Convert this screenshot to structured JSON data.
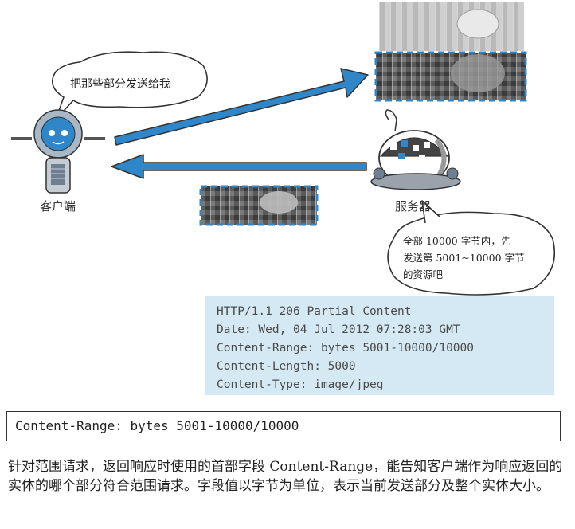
{
  "diagram": {
    "client_bubble": "把那些部分发送给我",
    "client_label": "客户端",
    "server_label": "服务器",
    "server_bubble_lines": [
      "全部 10000 字节内，先",
      "发送第 5001~10000 字节",
      "的资源吧"
    ],
    "arrow_color": "#2f86c8",
    "dashed_color": "#2f86c8"
  },
  "http_response": {
    "lines": [
      "HTTP/1.1 206 Partial Content",
      "Date: Wed, 04 Jul 2012 07:28:03 GMT",
      "Content-Range: bytes 5001-10000/10000",
      "Content-Length: 5000",
      "Content-Type: image/jpeg"
    ],
    "background": "#d5e9f4"
  },
  "header_field": "Content-Range: bytes 5001-10000/10000",
  "description": "针对范围请求，返回响应时使用的首部字段 Content-Range，能告知客户端作为响应返回的实体的哪个部分符合范围请求。字段值以字节为单位，表示当前发送部分及整个实体大小。"
}
